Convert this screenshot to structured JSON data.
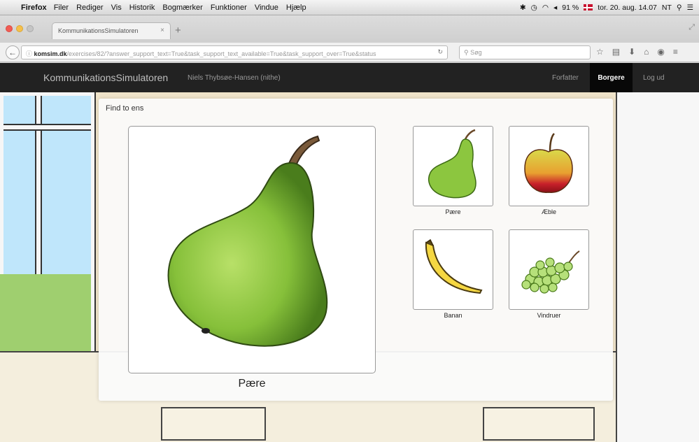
{
  "mac_menubar": {
    "app_name": "Firefox",
    "menus": [
      "Filer",
      "Rediger",
      "Vis",
      "Historik",
      "Bogmærker",
      "Funktioner",
      "Vindue",
      "Hjælp"
    ],
    "battery": "91 %",
    "datetime": "tor. 20. aug. 14.07",
    "user_initials": "NT"
  },
  "browser": {
    "tab_title": "KommunikationsSimulatoren",
    "url_host": "komsim.dk",
    "url_path": "/exercises/82/?answer_support_text=True&task_support_text_available=True&task_support_over=True&status",
    "search_placeholder": "Søg"
  },
  "app": {
    "brand": "KommunikationsSimulatoren",
    "user": "Niels Thybsøe-Hansen (nithe)",
    "nav": {
      "forfatter": "Forfatter",
      "borgere": "Borgere",
      "logout": "Log ud"
    }
  },
  "exercise": {
    "title": "Find to ens",
    "target": {
      "label": "Pære",
      "image": "pear"
    },
    "options": [
      {
        "label": "Pære",
        "image": "pear"
      },
      {
        "label": "Æble",
        "image": "apple"
      },
      {
        "label": "Banan",
        "image": "banana"
      },
      {
        "label": "Vindruer",
        "image": "grapes"
      }
    ]
  },
  "colors": {
    "appbar_bg": "#222222",
    "active_nav_bg": "#080808",
    "pear_green": "#8dc63f",
    "apple_red": "#c8202a",
    "banana_yellow": "#f5d742",
    "grape_green": "#b6e07a"
  }
}
